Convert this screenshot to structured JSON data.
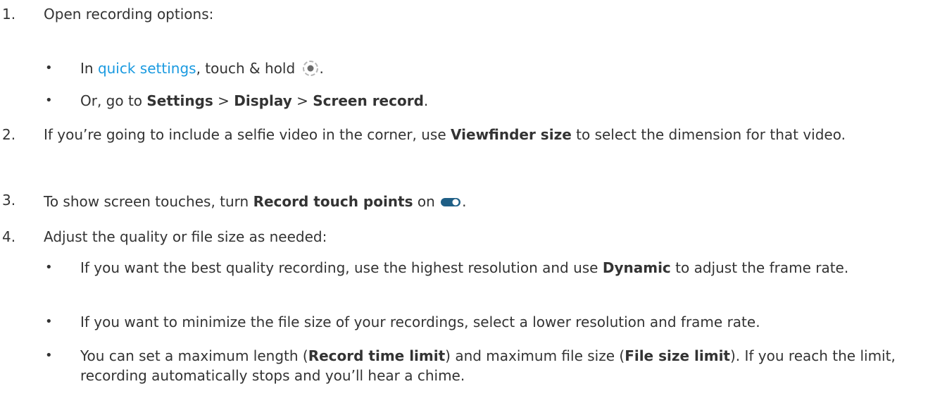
{
  "colors": {
    "text": "#333333",
    "link": "#1a9ae0",
    "toggle_track": "#1f5f86",
    "toggle_thumb": "#ffffff"
  },
  "steps": [
    {
      "number": "1.",
      "text": "Open recording options:",
      "subs": [
        {
          "bullet": "•",
          "pre": "In ",
          "link": "quick settings",
          "mid": ", touch & hold ",
          "icon": "screen-record-icon",
          "post": "."
        },
        {
          "bullet": "•",
          "pre": "Or, go to ",
          "b1": "Settings",
          "sep1": " > ",
          "b2": "Display",
          "sep2": " > ",
          "b3": "Screen record",
          "post": "."
        }
      ]
    },
    {
      "number": "2.",
      "pre": "If you’re going to include a selfie video in the corner, use ",
      "bold": "Viewfinder size",
      "post": " to select the dimension for that video."
    },
    {
      "number": "3.",
      "pre": "To show screen touches, turn ",
      "bold": "Record touch points",
      "mid": " on ",
      "icon": "toggle-on-icon",
      "post": "."
    },
    {
      "number": "4.",
      "text": "Adjust the quality or file size as needed:",
      "subs": [
        {
          "bullet": "•",
          "pre": "If you want the best quality recording, use the highest resolution and use ",
          "bold": "Dynamic",
          "post": " to adjust the frame rate."
        },
        {
          "bullet": "•",
          "text": "If you want to minimize the file size of your recordings, select a lower resolution and frame rate."
        },
        {
          "bullet": "•",
          "pre": "You can set a maximum length (",
          "b1": "Record time limit",
          "mid": ") and maximum file size (",
          "b2": "File size limit",
          "post": "). If you reach the limit, recording automatically stops and you’ll hear a chime."
        }
      ]
    }
  ]
}
